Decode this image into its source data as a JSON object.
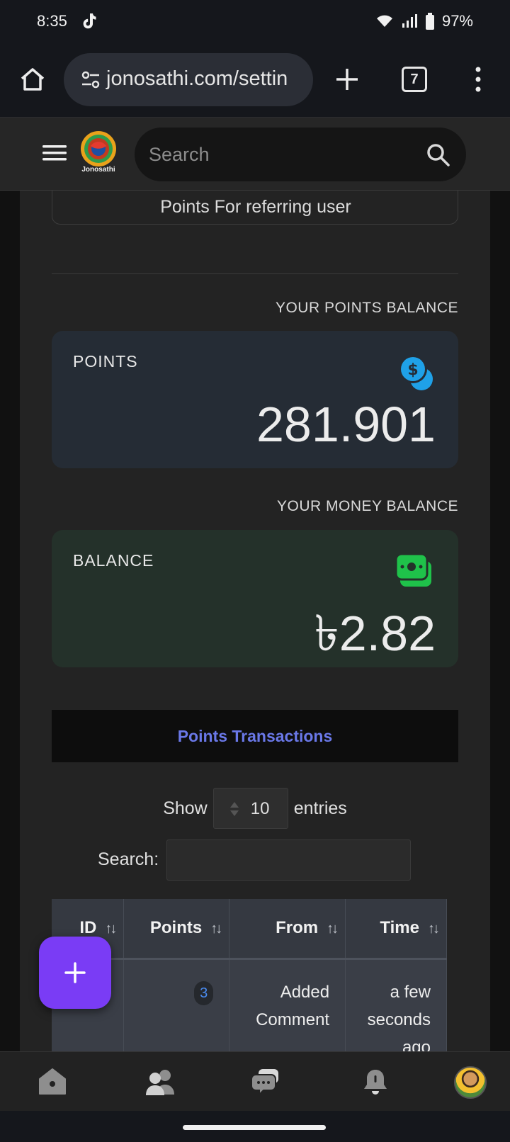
{
  "status_bar": {
    "time": "8:35",
    "battery": "97%",
    "icons": [
      "tiktok-icon",
      "wifi-icon",
      "signal-icon",
      "battery-icon"
    ]
  },
  "browser": {
    "url": "jonosathi.com/settin",
    "tab_count": "7"
  },
  "header": {
    "logo_text": "Jonosathi",
    "search_placeholder": "Search"
  },
  "referral": {
    "text": "Points For referring user"
  },
  "points_section": {
    "heading": "YOUR POINTS BALANCE",
    "label": "POINTS",
    "value": "281.901",
    "icon": "coins-icon",
    "accent": "#1fa1e8"
  },
  "money_section": {
    "heading": "YOUR MONEY BALANCE",
    "label": "BALANCE",
    "value": "৳2.82",
    "icon": "money-icon",
    "accent": "#1fc24a"
  },
  "transactions": {
    "tab_label": "Points Transactions",
    "show_label": "Show",
    "entries_value": "10",
    "entries_label": "entries",
    "search_label": "Search:",
    "columns": [
      "ID",
      "Points",
      "From",
      "Time"
    ],
    "sort_glyph": "↑↓",
    "rows": [
      {
        "id": "",
        "points": "3",
        "from": "Added Comment",
        "time": "a few seconds ago"
      }
    ]
  },
  "fab": {
    "label": "+"
  },
  "bottom_nav": {
    "items": [
      "home-icon",
      "friends-icon",
      "messages-icon",
      "notifications-icon",
      "profile-avatar"
    ]
  }
}
